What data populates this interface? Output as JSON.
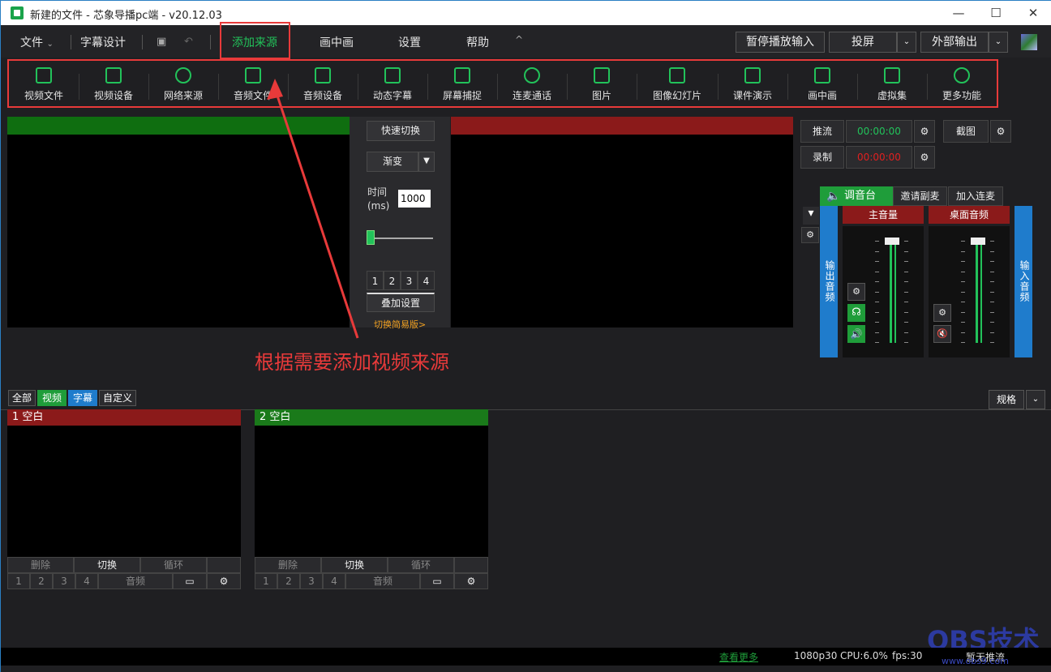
{
  "window": {
    "title": "新建的文件 - 芯象导播pc端 - v20.12.03",
    "min": "—",
    "max": "☐",
    "close": "✕"
  },
  "menu": {
    "file": "文件",
    "subtitle": "字幕设计",
    "add_source": "添加来源",
    "pip": "画中画",
    "settings": "设置",
    "help": "帮助",
    "collapse": "^"
  },
  "top_buttons": {
    "pause_input": "暂停播放输入",
    "cast": "投屏",
    "external_output": "外部输出"
  },
  "toolbar": [
    {
      "label": "视频文件",
      "icon": "video-file-icon"
    },
    {
      "label": "视频设备",
      "icon": "video-camera-icon"
    },
    {
      "label": "网络来源",
      "icon": "network-source-icon"
    },
    {
      "label": "音频文件",
      "icon": "audio-file-icon"
    },
    {
      "label": "音频设备",
      "icon": "microphone-icon"
    },
    {
      "label": "动态字幕",
      "icon": "dynamic-subtitle-icon"
    },
    {
      "label": "屏幕捕捉",
      "icon": "screen-capture-icon"
    },
    {
      "label": "连麦通话",
      "icon": "call-icon"
    },
    {
      "label": "图片",
      "icon": "image-icon"
    },
    {
      "label": "图像幻灯片",
      "icon": "slideshow-icon"
    },
    {
      "label": "课件演示",
      "icon": "courseware-icon"
    },
    {
      "label": "画中画",
      "icon": "pip-icon"
    },
    {
      "label": "虚拟集",
      "icon": "virtual-set-icon"
    },
    {
      "label": "更多功能",
      "icon": "more-icon"
    }
  ],
  "transition": {
    "quick_switch": "快速切换",
    "mode": "渐变",
    "time_label": "时间",
    "time_unit": "(ms)",
    "time_value": "1000",
    "slider_level": 0.0,
    "overlay_nums": [
      "1",
      "2",
      "3",
      "4"
    ],
    "overlay_settings": "叠加设置",
    "simple_mode": "切换简易版>"
  },
  "stream": {
    "push_label": "推流",
    "push_time": "00:00:00",
    "record_label": "录制",
    "record_time": "00:00:00",
    "screenshot": "截图"
  },
  "mixer": {
    "tab_mixer": "调音台",
    "tab_invite": "邀请副麦",
    "tab_join": "加入连麦",
    "output_audio": "输出音频",
    "input_audio": "输入音频",
    "main_volume": "主音量",
    "desktop_audio": "桌面音频"
  },
  "annotation": "根据需要添加视频来源",
  "filters": {
    "all": "全部",
    "video": "视频",
    "subtitle": "字幕",
    "custom": "自定义",
    "spec": "规格"
  },
  "scenes": [
    {
      "header": "1 空白",
      "color": "#8b1a1a"
    },
    {
      "header": "2 空白",
      "color": "#1a7a1a"
    }
  ],
  "scene_controls": {
    "delete": "删除",
    "switch": "切换",
    "loop": "循环",
    "nums": [
      "1",
      "2",
      "3",
      "4"
    ],
    "audio": "音频"
  },
  "status": {
    "more": "查看更多",
    "resolution": "1080p30",
    "cpu": "CPU:6.0%",
    "fps": "fps:30",
    "stream_state": "暂无推流"
  },
  "watermark": {
    "brand": "OBS技术",
    "url": "www.obs9.com"
  },
  "colors": {
    "accent_green": "#22c25a",
    "red": "#e83a3a",
    "preview_green": "#0f6e10",
    "program_red": "#8b1a1a",
    "blue": "#1f7ccc"
  }
}
